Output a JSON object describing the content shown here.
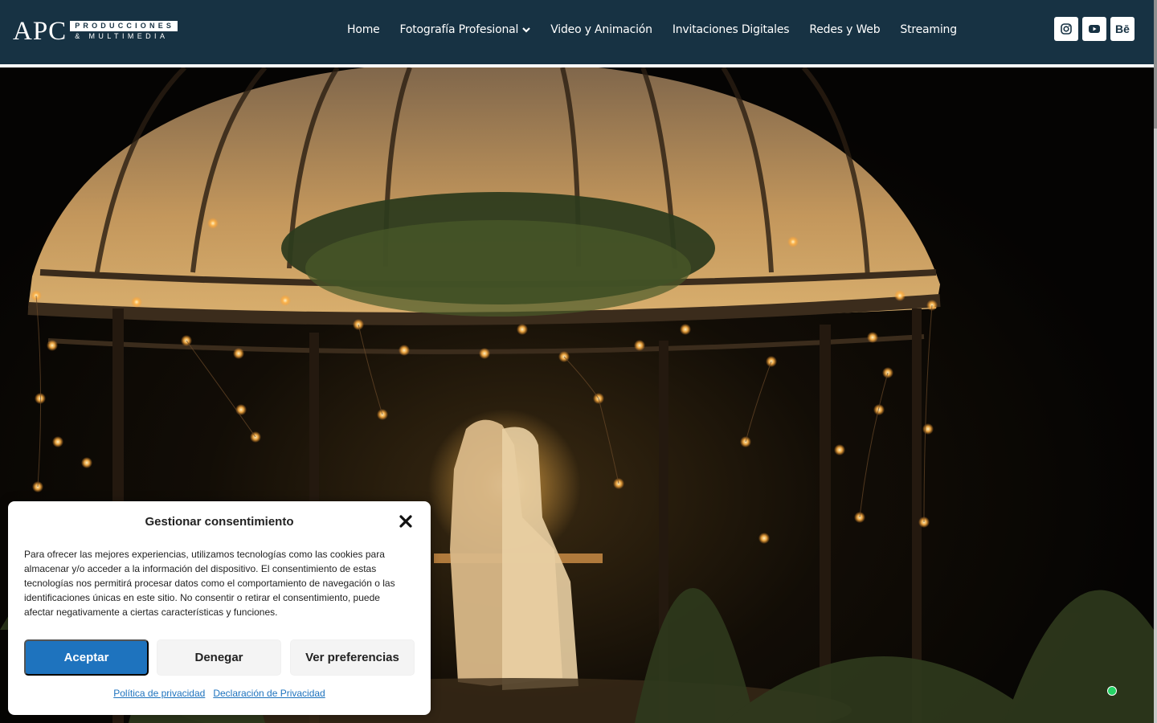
{
  "header": {
    "logo": {
      "letters": "APC",
      "line1": "PRODUCCIONES",
      "line2": "& MULTIMEDIA"
    },
    "nav": [
      {
        "label": "Home"
      },
      {
        "label": "Fotografía Profesional",
        "has_dropdown": true
      },
      {
        "label": "Video y Animación"
      },
      {
        "label": "Invitaciones Digitales"
      },
      {
        "label": "Redes y Web"
      },
      {
        "label": "Streaming"
      }
    ],
    "socials": [
      {
        "icon": "instagram-icon"
      },
      {
        "icon": "youtube-icon"
      },
      {
        "icon": "behance-icon",
        "text": "Bē"
      }
    ]
  },
  "hero": {
    "image": "night wedding couple under illuminated glass gazebo with hanging string lights"
  },
  "consent": {
    "title": "Gestionar consentimiento",
    "body": "Para ofrecer las mejores experiencias, utilizamos tecnologías como las cookies para almacenar y/o acceder a la información del dispositivo. El consentimiento de estas tecnologías nos permitirá procesar datos como el comportamiento de navegación o las identificaciones únicas en este sitio. No consentir o retirar el consentimiento, puede afectar negativamente a ciertas características y funciones.",
    "accept_label": "Aceptar",
    "deny_label": "Denegar",
    "prefs_label": "Ver preferencias",
    "links": [
      {
        "label": "Política de privacidad"
      },
      {
        "label": "Declaración de Privacidad"
      }
    ]
  },
  "colors": {
    "header_bg": "#173243",
    "accent": "#1e73be",
    "whatsapp": "#25d366"
  }
}
